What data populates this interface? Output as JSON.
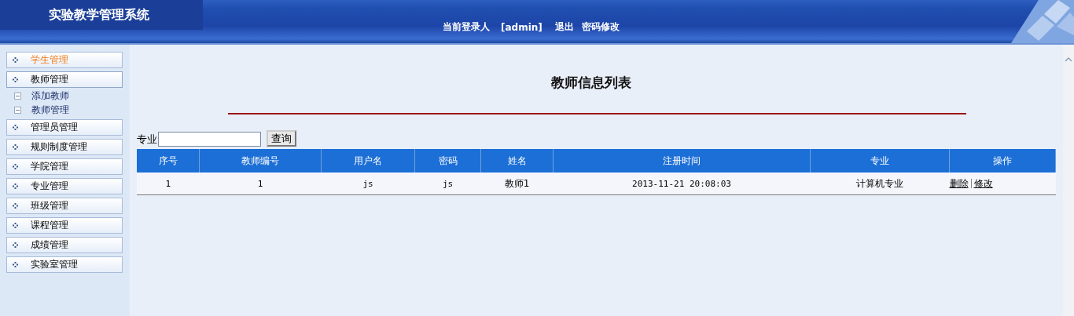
{
  "header": {
    "title": "实验教学管理系统",
    "user_label": "当前登录人",
    "user_name": "[admin]",
    "links": [
      "退出",
      "密码修改"
    ]
  },
  "sidebar": {
    "items": [
      {
        "label": "学生管理",
        "selected": true,
        "expanded": false
      },
      {
        "label": "教师管理",
        "selected": false,
        "expanded": true,
        "children": [
          {
            "label": "添加教师"
          },
          {
            "label": "教师管理"
          }
        ]
      },
      {
        "label": "管理员管理",
        "selected": false,
        "expanded": false
      },
      {
        "label": "规则制度管理",
        "selected": false,
        "expanded": false
      },
      {
        "label": "学院管理",
        "selected": false,
        "expanded": false
      },
      {
        "label": "专业管理",
        "selected": false,
        "expanded": false
      },
      {
        "label": "班级管理",
        "selected": false,
        "expanded": false
      },
      {
        "label": "课程管理",
        "selected": false,
        "expanded": false
      },
      {
        "label": "成绩管理",
        "selected": false,
        "expanded": false
      },
      {
        "label": "实验室管理",
        "selected": false,
        "expanded": false
      }
    ]
  },
  "main": {
    "title": "教师信息列表",
    "search": {
      "label": "专业",
      "button": "查询"
    },
    "table": {
      "columns": [
        "序号",
        "教师编号",
        "用户名",
        "密码",
        "姓名",
        "注册时间",
        "专业",
        "操作"
      ],
      "rows": [
        {
          "cells": [
            "1",
            "1",
            "js",
            "js",
            "教师1",
            "2013-11-21 20:08:03",
            "计算机专业"
          ],
          "actions": [
            "删除",
            "修改"
          ]
        }
      ]
    }
  }
}
